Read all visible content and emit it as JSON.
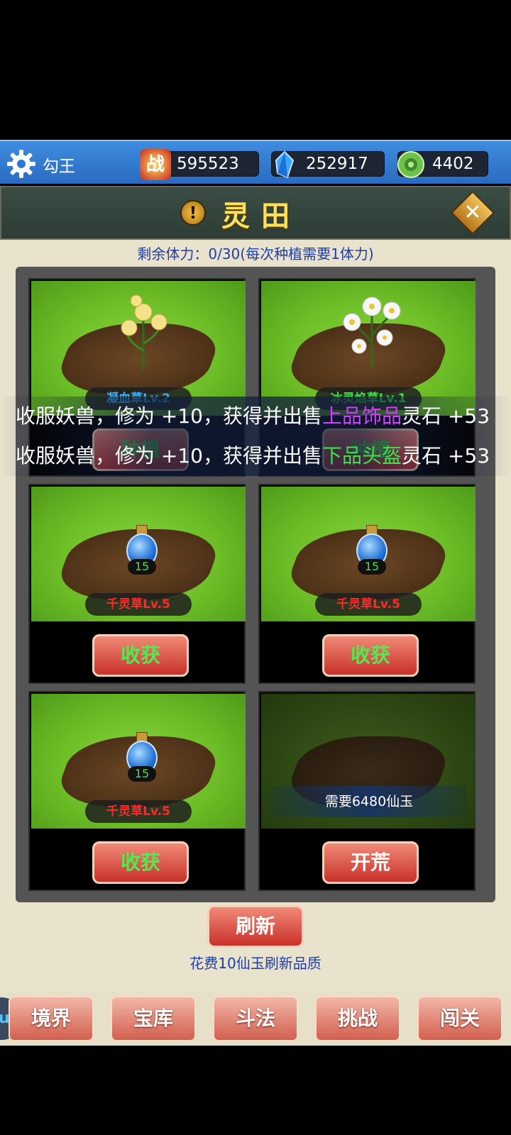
{
  "topbar": {
    "username": "勾王",
    "combat_icon_text": "战",
    "combat_power": "595523",
    "crystals": "252917",
    "jade": "4402"
  },
  "header": {
    "title": "灵田",
    "info_icon": "!",
    "close_icon": "✕"
  },
  "stamina_text": "剩余体力：0/30(每次种植需要1体力)",
  "plots": [
    {
      "label": "凝血草Lv.2",
      "button": "种植"
    },
    {
      "label": "冰灵焰草Lv.1",
      "button": "种植"
    },
    {
      "label": "千灵草Lv.5",
      "count": "15",
      "button": "收获"
    },
    {
      "label": "千灵草Lv.5",
      "count": "15",
      "button": "收获"
    },
    {
      "label": "千灵草Lv.5",
      "count": "15",
      "button": "收获"
    },
    {
      "locked_text": "需要6480仙玉",
      "button": "开荒"
    }
  ],
  "messages": [
    {
      "prefix": "收服妖兽，修为 +10，获得并出售",
      "item": "上品饰品",
      "suffix": "灵石 +53"
    },
    {
      "prefix": "收服妖兽，修为 +10，获得并出售",
      "item": "下品头盔",
      "suffix": "灵石 +53"
    }
  ],
  "refresh": {
    "label": "刷新",
    "note": "花费10仙玉刷新品质"
  },
  "nav": {
    "side_text": "up",
    "items": [
      "境界",
      "宝库",
      "斗法",
      "挑战",
      "闯关"
    ]
  },
  "colors": {
    "title": "#ffe05a",
    "blue_text": "#1f3ea6",
    "harvest_green": "#46f04e",
    "item_purple": "#d63bff",
    "item_green": "#3fe04a"
  }
}
